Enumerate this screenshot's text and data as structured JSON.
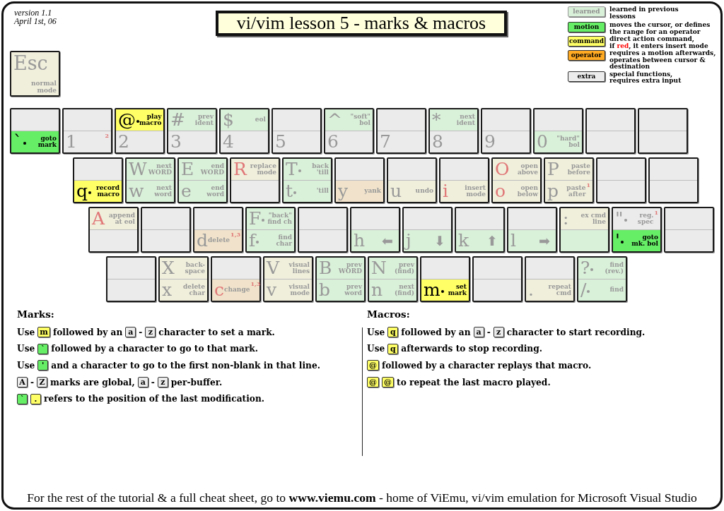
{
  "version": {
    "number": "version 1.1",
    "date": "April 1st, 06"
  },
  "esc_key": {
    "kind": "command",
    "learned": true,
    "char": "Esc",
    "label": "normal\nmode"
  },
  "title": "vi/vim lesson 5 - marks & macros",
  "legend": [
    {
      "kind": "learned",
      "sample": "learned",
      "parts": [
        {
          "kind": "plain",
          "text": "learned in previous\nlessons"
        }
      ]
    },
    {
      "kind": "motion",
      "sample": "motion",
      "parts": [
        {
          "kind": "plain",
          "text": "moves the cursor, or defines\nthe range for an operator"
        }
      ]
    },
    {
      "kind": "command",
      "sample": "command",
      "parts": [
        {
          "kind": "plain",
          "text": "direct action command,\nif "
        },
        {
          "kind": "red",
          "text": "red"
        },
        {
          "kind": "plain",
          "text": ", it enters insert mode"
        }
      ]
    },
    {
      "kind": "operator",
      "sample": "operator",
      "parts": [
        {
          "kind": "plain",
          "text": "requires a motion afterwards,\noperates between cursor  &\ndestination"
        }
      ]
    },
    {
      "kind": "extra",
      "sample": "extra",
      "parts": [
        {
          "kind": "plain",
          "text": "special functions,\nrequires extra input"
        }
      ]
    }
  ],
  "keyboard": {
    "rows": [
      {
        "keys": [
          {
            "top": {
              "kind": "blank"
            },
            "bottom": {
              "kind": "motion",
              "learned": false,
              "char": "`",
              "red": false,
              "arg": true,
              "label": "goto\nmark"
            }
          },
          {
            "top": {
              "kind": "blank"
            },
            "bottom": {
              "kind": "extra",
              "learned": true,
              "char": "1",
              "red": false,
              "arg": false,
              "note": "2"
            }
          },
          {
            "top": {
              "kind": "command",
              "learned": false,
              "char": "@",
              "red": false,
              "arg": true,
              "label": "play\nmacro"
            },
            "bottom": {
              "kind": "extra",
              "learned": true,
              "char": "2",
              "red": false,
              "arg": false
            }
          },
          {
            "top": {
              "kind": "motion",
              "learned": true,
              "char": "#",
              "red": false,
              "arg": false,
              "label": "prev\nident"
            },
            "bottom": {
              "kind": "extra",
              "learned": true,
              "char": "3",
              "red": false,
              "arg": false
            }
          },
          {
            "top": {
              "kind": "motion",
              "learned": true,
              "char": "$",
              "red": false,
              "arg": false,
              "label": "eol"
            },
            "bottom": {
              "kind": "extra",
              "learned": true,
              "char": "4",
              "red": false,
              "arg": false
            }
          },
          {
            "top": {
              "kind": "blank"
            },
            "bottom": {
              "kind": "extra",
              "learned": true,
              "char": "5",
              "red": false,
              "arg": false
            }
          },
          {
            "top": {
              "kind": "motion",
              "learned": true,
              "char": "^",
              "red": false,
              "arg": false,
              "label": "\"soft\"\nbol"
            },
            "bottom": {
              "kind": "extra",
              "learned": true,
              "char": "6",
              "red": false,
              "arg": false
            }
          },
          {
            "top": {
              "kind": "blank"
            },
            "bottom": {
              "kind": "extra",
              "learned": true,
              "char": "7",
              "red": false,
              "arg": false
            }
          },
          {
            "top": {
              "kind": "motion",
              "learned": true,
              "char": "*",
              "red": false,
              "arg": false,
              "label": "next\nident"
            },
            "bottom": {
              "kind": "extra",
              "learned": true,
              "char": "8",
              "red": false,
              "arg": false
            }
          },
          {
            "top": {
              "kind": "blank"
            },
            "bottom": {
              "kind": "extra",
              "learned": true,
              "char": "9",
              "red": false,
              "arg": false
            }
          },
          {
            "top": {
              "kind": "blank"
            },
            "bottom": {
              "kind": "motion",
              "learned": true,
              "char": "0",
              "red": false,
              "arg": false,
              "label": "\"hard\"\nbol"
            }
          },
          {
            "top": {
              "kind": "blank"
            },
            "bottom": {
              "kind": "blank"
            }
          },
          {
            "top": {
              "kind": "blank"
            },
            "bottom": {
              "kind": "blank"
            }
          }
        ]
      },
      {
        "keys": [
          {
            "top": {
              "kind": "blank"
            },
            "bottom": {
              "kind": "command",
              "learned": false,
              "char": "q",
              "red": false,
              "arg": true,
              "label": "record\nmacro"
            }
          },
          {
            "top": {
              "kind": "motion",
              "learned": true,
              "char": "W",
              "red": false,
              "arg": false,
              "label": "next\nWORD"
            },
            "bottom": {
              "kind": "motion",
              "learned": true,
              "char": "w",
              "red": false,
              "arg": false,
              "label": "next\nword"
            }
          },
          {
            "top": {
              "kind": "motion",
              "learned": true,
              "char": "E",
              "red": false,
              "arg": false,
              "label": "end\nWORD"
            },
            "bottom": {
              "kind": "motion",
              "learned": true,
              "char": "e",
              "red": false,
              "arg": false,
              "label": "end\nword"
            }
          },
          {
            "top": {
              "kind": "command",
              "learned": true,
              "char": "R",
              "red": true,
              "arg": false,
              "label": "replace\nmode"
            },
            "bottom": {
              "kind": "blank"
            }
          },
          {
            "top": {
              "kind": "motion",
              "learned": true,
              "char": "T",
              "red": false,
              "arg": true,
              "label": "back\n'till"
            },
            "bottom": {
              "kind": "motion",
              "learned": true,
              "char": "t",
              "red": false,
              "arg": true,
              "label": "'till"
            }
          },
          {
            "top": {
              "kind": "blank"
            },
            "bottom": {
              "kind": "operator",
              "learned": true,
              "char": "y",
              "red": false,
              "arg": false,
              "label": "yank"
            }
          },
          {
            "top": {
              "kind": "blank"
            },
            "bottom": {
              "kind": "command",
              "learned": true,
              "char": "u",
              "red": false,
              "arg": false,
              "label": "undo"
            }
          },
          {
            "top": {
              "kind": "blank"
            },
            "bottom": {
              "kind": "command",
              "learned": true,
              "char": "i",
              "red": true,
              "arg": false,
              "label": "insert\nmode"
            }
          },
          {
            "top": {
              "kind": "command",
              "learned": true,
              "char": "O",
              "red": true,
              "arg": false,
              "label": "open\nabove"
            },
            "bottom": {
              "kind": "command",
              "learned": true,
              "char": "o",
              "red": true,
              "arg": false,
              "label": "open\nbelow"
            }
          },
          {
            "top": {
              "kind": "command",
              "learned": true,
              "char": "P",
              "red": false,
              "arg": false,
              "label": "paste\nbefore"
            },
            "bottom": {
              "kind": "command",
              "learned": true,
              "char": "p",
              "red": false,
              "arg": false,
              "label": "paste\nafter",
              "note": "1"
            }
          },
          {
            "top": {
              "kind": "blank"
            },
            "bottom": {
              "kind": "blank"
            }
          },
          {
            "top": {
              "kind": "blank"
            },
            "bottom": {
              "kind": "blank"
            }
          }
        ]
      },
      {
        "keys": [
          {
            "top": {
              "kind": "command",
              "learned": true,
              "char": "A",
              "red": true,
              "arg": false,
              "label": "append\nat eol"
            },
            "bottom": {
              "kind": "blank"
            }
          },
          {
            "top": {
              "kind": "blank"
            },
            "bottom": {
              "kind": "blank"
            }
          },
          {
            "top": {
              "kind": "blank"
            },
            "bottom": {
              "kind": "operator",
              "learned": true,
              "char": "d",
              "red": false,
              "arg": false,
              "label": "delete",
              "note": "1,3"
            }
          },
          {
            "top": {
              "kind": "motion",
              "learned": true,
              "char": "F",
              "red": false,
              "arg": true,
              "label": "\"back\"\nfind ch"
            },
            "bottom": {
              "kind": "motion",
              "learned": true,
              "char": "f",
              "red": false,
              "arg": true,
              "label": "find\nchar"
            }
          },
          {
            "top": {
              "kind": "blank"
            },
            "bottom": {
              "kind": "blank"
            }
          },
          {
            "top": {
              "kind": "blank"
            },
            "bottom": {
              "kind": "motion",
              "learned": true,
              "char": "h",
              "red": false,
              "arg": false,
              "glyph": "⬅"
            }
          },
          {
            "top": {
              "kind": "blank"
            },
            "bottom": {
              "kind": "motion",
              "learned": true,
              "char": "j",
              "red": false,
              "arg": false,
              "glyph": "⬇"
            }
          },
          {
            "top": {
              "kind": "blank"
            },
            "bottom": {
              "kind": "motion",
              "learned": true,
              "char": "k",
              "red": false,
              "arg": false,
              "glyph": "⬆"
            }
          },
          {
            "top": {
              "kind": "blank"
            },
            "bottom": {
              "kind": "motion",
              "learned": true,
              "char": "l",
              "red": false,
              "arg": false,
              "glyph": "➡"
            }
          },
          {
            "top": {
              "kind": "command",
              "learned": true,
              "char": ":",
              "red": false,
              "arg": false,
              "label": "ex cmd\nline"
            },
            "bottom": {
              "kind": "motion",
              "learned": true
            }
          },
          {
            "top": {
              "kind": "extra",
              "learned": true,
              "char": "\"",
              "red": false,
              "arg": true,
              "label": "reg.\nspec",
              "note": "1"
            },
            "bottom": {
              "kind": "motion",
              "learned": false,
              "char": "'",
              "red": false,
              "arg": true,
              "label": "goto\nmk. bol"
            }
          },
          {
            "top": {
              "kind": "blank"
            },
            "bottom": {
              "kind": "blank"
            }
          }
        ]
      },
      {
        "keys": [
          {
            "top": {
              "kind": "blank"
            },
            "bottom": {
              "kind": "blank"
            }
          },
          {
            "top": {
              "kind": "command",
              "learned": true,
              "char": "X",
              "red": false,
              "arg": false,
              "label": "back-\nspace"
            },
            "bottom": {
              "kind": "command",
              "learned": true,
              "char": "x",
              "red": false,
              "arg": false,
              "label": "delete\nchar"
            }
          },
          {
            "top": {
              "kind": "blank"
            },
            "bottom": {
              "kind": "operator",
              "learned": true,
              "char": "c",
              "red": true,
              "arg": false,
              "label": "change",
              "note": "1,3"
            }
          },
          {
            "top": {
              "kind": "command",
              "learned": true,
              "char": "V",
              "red": false,
              "arg": false,
              "label": "visual\nlines"
            },
            "bottom": {
              "kind": "command",
              "learned": true,
              "char": "v",
              "red": false,
              "arg": false,
              "label": "visual\nmode"
            }
          },
          {
            "top": {
              "kind": "motion",
              "learned": true,
              "char": "B",
              "red": false,
              "arg": false,
              "label": "prev\nWORD"
            },
            "bottom": {
              "kind": "motion",
              "learned": true,
              "char": "b",
              "red": false,
              "arg": false,
              "label": "prev\nword"
            }
          },
          {
            "top": {
              "kind": "motion",
              "learned": true,
              "char": "N",
              "red": false,
              "arg": false,
              "label": "prev\n(find)"
            },
            "bottom": {
              "kind": "motion",
              "learned": true,
              "char": "n",
              "red": false,
              "arg": false,
              "label": "next\n(find)"
            }
          },
          {
            "top": {
              "kind": "blank"
            },
            "bottom": {
              "kind": "command",
              "learned": false,
              "char": "m",
              "red": false,
              "arg": true,
              "label": "set\nmark"
            }
          },
          {
            "top": {
              "kind": "blank"
            },
            "bottom": {
              "kind": "blank"
            }
          },
          {
            "top": {
              "kind": "blank"
            },
            "bottom": {
              "kind": "command",
              "learned": true,
              "char": ".",
              "red": false,
              "arg": false,
              "label": "repeat\ncmd"
            }
          },
          {
            "top": {
              "kind": "motion",
              "learned": true,
              "char": "?",
              "red": false,
              "arg": true,
              "label": "find\n(rev.)"
            },
            "bottom": {
              "kind": "motion",
              "learned": true,
              "char": "/",
              "red": false,
              "arg": true,
              "label": "find"
            }
          }
        ]
      }
    ]
  },
  "marks": {
    "heading": "Marks:",
    "lines": [
      {
        "parts": [
          {
            "kind": "text",
            "text": "Use"
          },
          {
            "kind": "command-key",
            "char": "m"
          },
          {
            "kind": "text",
            "text": "followed by an"
          },
          {
            "kind": "extra-key",
            "char": "a"
          },
          {
            "kind": "text",
            "text": "-"
          },
          {
            "kind": "extra-key",
            "char": "z"
          },
          {
            "kind": "text",
            "text": "character to set a mark."
          }
        ]
      },
      {
        "parts": [
          {
            "kind": "text",
            "text": "Use"
          },
          {
            "kind": "motion-key",
            "char": "`"
          },
          {
            "kind": "text",
            "text": "followed by a character to go to that mark."
          }
        ]
      },
      {
        "parts": [
          {
            "kind": "text",
            "text": "Use"
          },
          {
            "kind": "motion-key",
            "char": "'"
          },
          {
            "kind": "text",
            "text": "and a character to go to the first non-blank in that line."
          }
        ]
      },
      {
        "parts": [
          {
            "kind": "extra-key",
            "char": "A"
          },
          {
            "kind": "text",
            "text": "-"
          },
          {
            "kind": "extra-key",
            "char": "Z"
          },
          {
            "kind": "text",
            "text": "marks are global,"
          },
          {
            "kind": "extra-key",
            "char": "a"
          },
          {
            "kind": "text",
            "text": "-"
          },
          {
            "kind": "extra-key",
            "char": "z"
          },
          {
            "kind": "text",
            "text": "per-buffer."
          }
        ]
      },
      {
        "parts": [
          {
            "kind": "motion-key",
            "char": "`"
          },
          {
            "kind": "command-key",
            "char": "."
          },
          {
            "kind": "text",
            "text": "refers to the position of the last modification."
          }
        ]
      }
    ]
  },
  "macros": {
    "heading": "Macros:",
    "lines": [
      {
        "parts": [
          {
            "kind": "text",
            "text": "Use"
          },
          {
            "kind": "command-key",
            "char": "q"
          },
          {
            "kind": "text",
            "text": "followed by an"
          },
          {
            "kind": "extra-key",
            "char": "a"
          },
          {
            "kind": "text",
            "text": "-"
          },
          {
            "kind": "extra-key",
            "char": "z"
          },
          {
            "kind": "text",
            "text": "character to start recording."
          }
        ]
      },
      {
        "parts": [
          {
            "kind": "text",
            "text": "Use"
          },
          {
            "kind": "command-key",
            "char": "q"
          },
          {
            "kind": "text",
            "text": "afterwards to stop recording."
          }
        ]
      },
      {
        "parts": [
          {
            "kind": "command-key",
            "char": "@"
          },
          {
            "kind": "text",
            "text": "followed by a character replays that macro."
          }
        ]
      },
      {
        "parts": [
          {
            "kind": "command-key",
            "char": "@"
          },
          {
            "kind": "command-key",
            "char": "@"
          },
          {
            "kind": "text",
            "text": "to repeat the last macro played."
          }
        ]
      }
    ]
  },
  "footer": "For the rest of the tutorial & a full cheat sheet, go to **www.viemu.com** - home of ViEmu, vi/vim emulation for Microsoft Visual Studio"
}
